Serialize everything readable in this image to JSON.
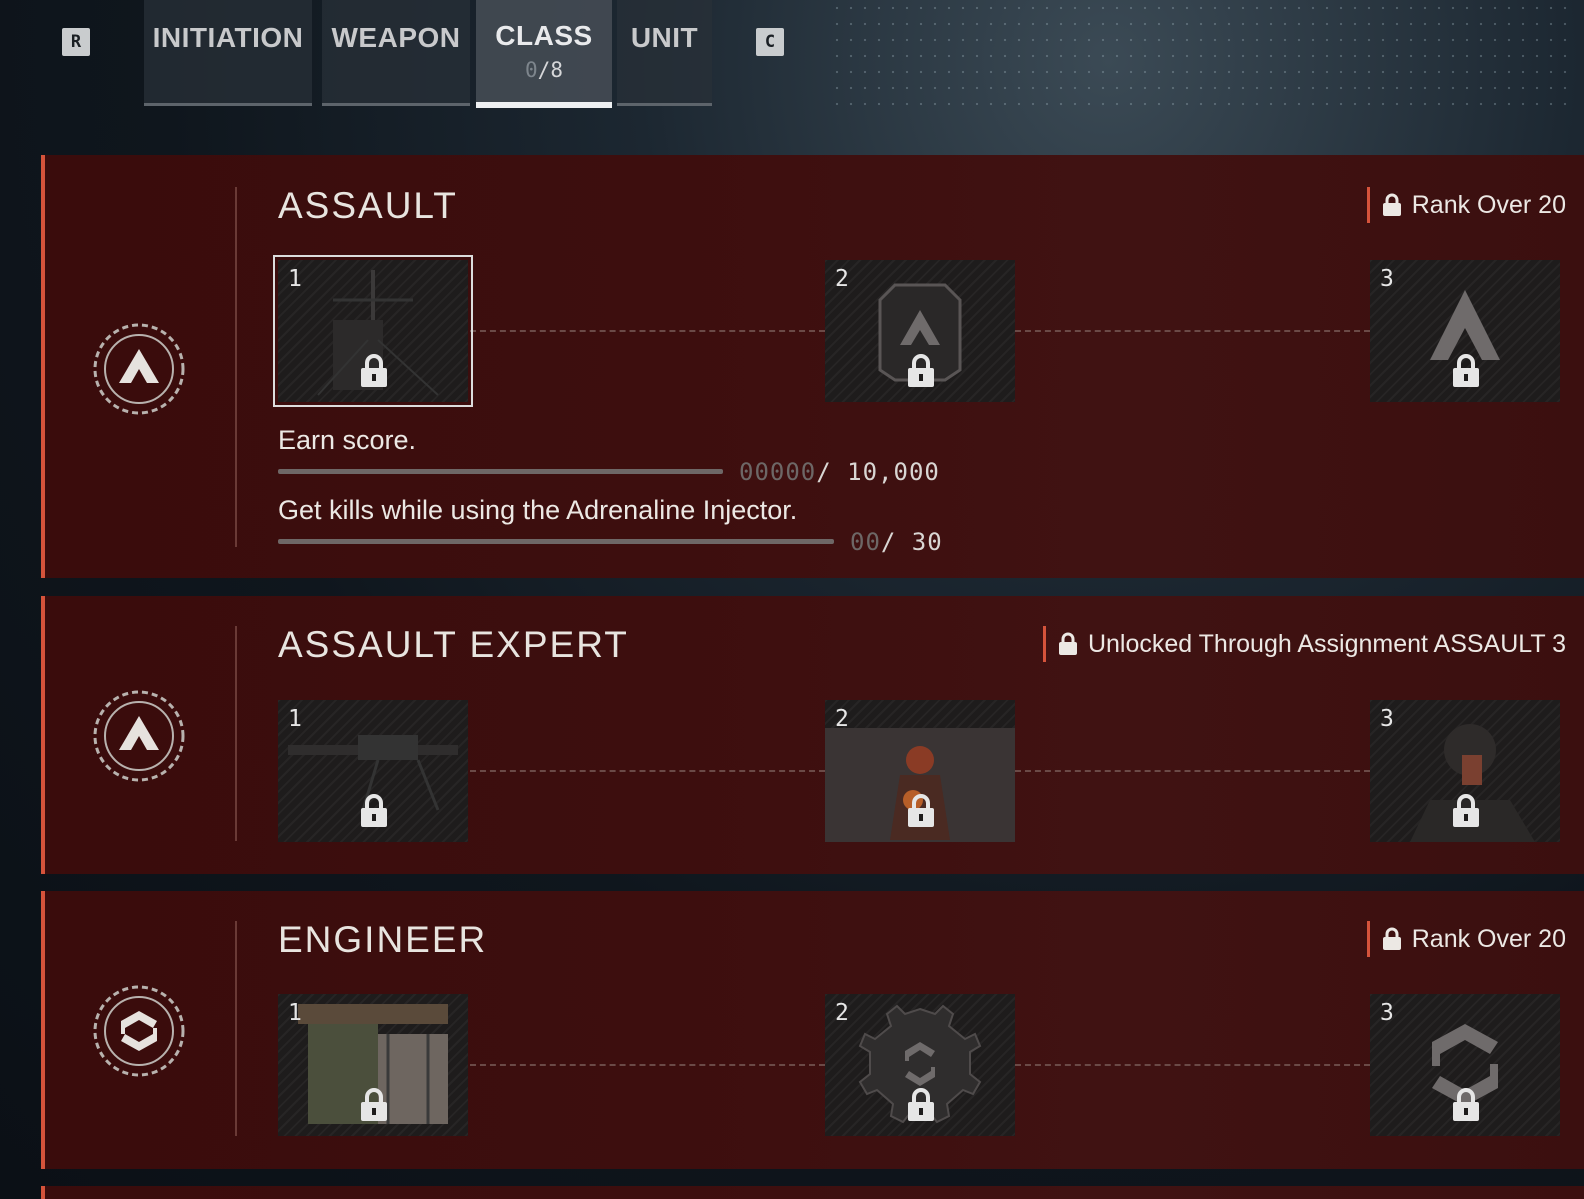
{
  "nav": {
    "left_key": "R",
    "right_key": "C",
    "tabs": [
      {
        "label": "INITIATION"
      },
      {
        "label": "WEAPON"
      },
      {
        "label": "CLASS",
        "count_done": "0",
        "count_total": "/8",
        "active": true
      },
      {
        "label": "UNIT"
      }
    ]
  },
  "classes": [
    {
      "title": "ASSAULT",
      "requirement": "Rank Over 20",
      "items": [
        {
          "num": "1",
          "selected": true
        },
        {
          "num": "2"
        },
        {
          "num": "3"
        }
      ],
      "tasks": [
        {
          "text": "Earn score.",
          "current": "00000",
          "total": "/ 10,000"
        },
        {
          "text": "Get kills while using the Adrenaline Injector.",
          "current": "00",
          "total": "/ 30"
        }
      ]
    },
    {
      "title": "ASSAULT EXPERT",
      "requirement": "Unlocked Through Assignment ASSAULT 3",
      "items": [
        {
          "num": "1"
        },
        {
          "num": "2"
        },
        {
          "num": "3"
        }
      ]
    },
    {
      "title": "ENGINEER",
      "requirement": "Rank Over 20",
      "items": [
        {
          "num": "1"
        },
        {
          "num": "2"
        },
        {
          "num": "3"
        }
      ]
    }
  ],
  "colors": {
    "accent": "#d5533b",
    "card_bg": "#3d0e0e"
  }
}
